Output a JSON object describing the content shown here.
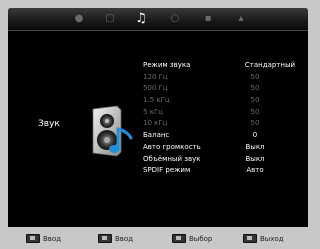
{
  "tabs": [
    {
      "icon": "picture-icon",
      "glyph": "●"
    },
    {
      "icon": "monitor-icon",
      "glyph": "▢"
    },
    {
      "icon": "music-note-icon",
      "glyph": "♫"
    },
    {
      "icon": "clock-icon",
      "glyph": "○"
    },
    {
      "icon": "grid-icon",
      "glyph": "▪"
    },
    {
      "icon": "lock-icon",
      "glyph": "▴"
    }
  ],
  "section": {
    "label": "Звук",
    "icon": "speaker-music-icon"
  },
  "menu": [
    {
      "label": "Режим звука",
      "value": "Стандартный",
      "state": "selected"
    },
    {
      "label": "120 Гц",
      "value": "50",
      "state": "disabled"
    },
    {
      "label": "500 Гц",
      "value": "50",
      "state": "disabled"
    },
    {
      "label": "1.5 кГц",
      "value": "50",
      "state": "disabled"
    },
    {
      "label": "5 кГц",
      "value": "50",
      "state": "disabled"
    },
    {
      "label": "10 кГц",
      "value": "50",
      "state": "disabled"
    },
    {
      "label": "Баланс",
      "value": "0",
      "state": "normal"
    },
    {
      "label": "Авто громкость",
      "value": "Выкл",
      "state": "normal"
    },
    {
      "label": "Объёмный звук",
      "value": "Выкл",
      "state": "normal"
    },
    {
      "label": "SPDIF режим",
      "value": "Авто",
      "state": "normal"
    }
  ],
  "hints": [
    {
      "key": "enter-key-icon",
      "label": "Ввод"
    },
    {
      "key": "ok-key-icon",
      "label": "Ввод"
    },
    {
      "key": "arrows-key-icon",
      "label": "Выбор"
    },
    {
      "key": "exit-key-icon",
      "label": "Выход"
    }
  ]
}
